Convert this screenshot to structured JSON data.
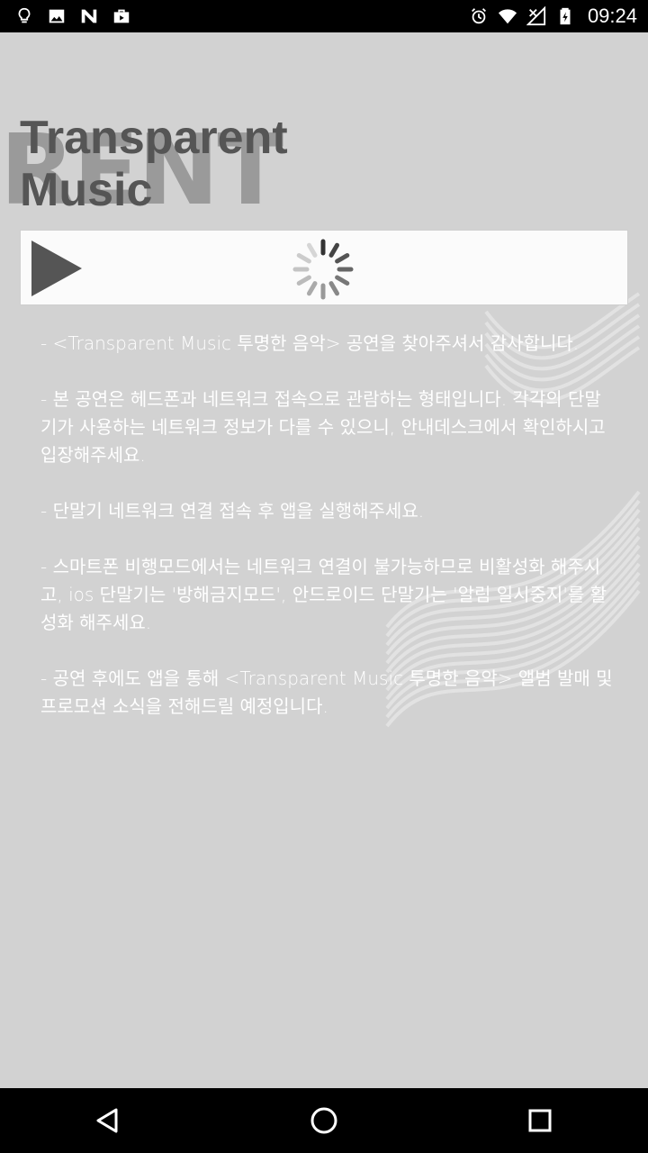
{
  "status_bar": {
    "time": "09:24",
    "left_icons": [
      "bulb-icon",
      "image-icon",
      "n-app-icon",
      "bag-icon"
    ],
    "right_icons": [
      "alarm-icon",
      "wifi-icon",
      "signal-off-icon",
      "battery-icon"
    ]
  },
  "app": {
    "title_line1": "Transparent",
    "title_line2": "Music",
    "watermark_text": "RENT"
  },
  "player": {
    "play_icon": "play-icon",
    "loading_icon": "spinner-icon"
  },
  "notice": {
    "paragraphs": [
      "- <Transparent Music 투명한 음악> 공연을 찾아주셔서 감사합니다.",
      "- 본 공연은 헤드폰과 네트워크 접속으로 관람하는 형태입니다. 각각의 단말기가 사용하는 네트워크 정보가 다를 수 있으니, 안내데스크에서 확인하시고 입장해주세요.",
      "- 단말기 네트워크 연결 접속 후 앱을 실행해주세요.",
      "- 스마트폰 비행모드에서는 네트워크 연결이 불가능하므로 비활성화 해주시고, ios 단말기는 '방해금지모드', 안드로이드 단말기는 '알림 일시중지'를 활성화 해주세요.",
      "- 공연 후에도 앱을 통해 <Transparent Music 투명한 음악> 앨범 발매 및 프로모션 소식을 전해드릴 예정입니다."
    ]
  },
  "nav": {
    "back_icon": "back-icon",
    "home_icon": "home-icon",
    "recents_icon": "recents-icon"
  },
  "colors": {
    "background": "#d2d2d2",
    "title": "#555555",
    "notice_text": "#ffffff",
    "player_bg": "#fbfbfb"
  }
}
